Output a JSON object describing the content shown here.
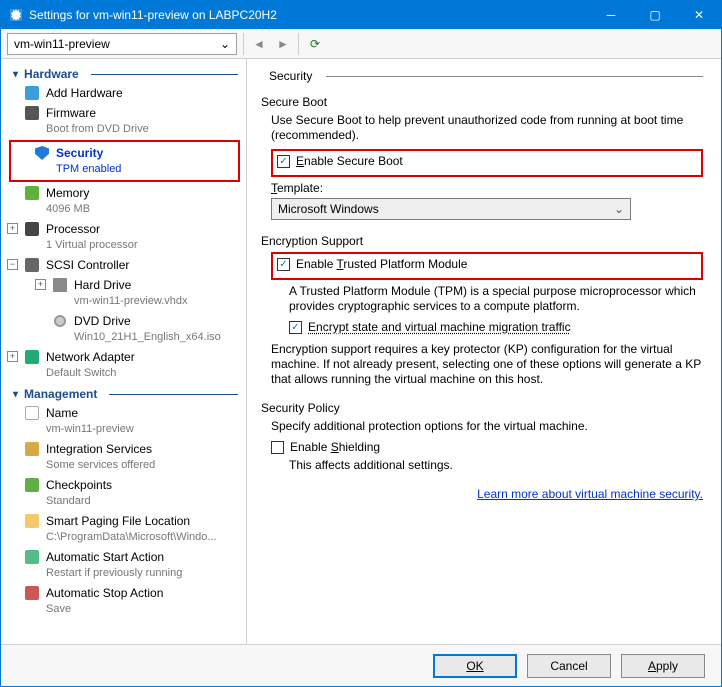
{
  "titlebar": {
    "text": "Settings for vm-win11-preview on LABPC20H2"
  },
  "toolbar": {
    "vm_name": "vm-win11-preview"
  },
  "sidebar": {
    "hardware_label": "Hardware",
    "management_label": "Management",
    "items": {
      "add_hardware": {
        "label": "Add Hardware"
      },
      "firmware": {
        "label": "Firmware",
        "sub": "Boot from DVD Drive"
      },
      "security": {
        "label": "Security",
        "sub": "TPM enabled"
      },
      "memory": {
        "label": "Memory",
        "sub": "4096 MB"
      },
      "processor": {
        "label": "Processor",
        "sub": "1 Virtual processor"
      },
      "scsi": {
        "label": "SCSI Controller"
      },
      "hard_drive": {
        "label": "Hard Drive",
        "sub": "vm-win11-preview.vhdx"
      },
      "dvd_drive": {
        "label": "DVD Drive",
        "sub": "Win10_21H1_English_x64.iso"
      },
      "network": {
        "label": "Network Adapter",
        "sub": "Default Switch"
      },
      "name": {
        "label": "Name",
        "sub": "vm-win11-preview"
      },
      "integration": {
        "label": "Integration Services",
        "sub": "Some services offered"
      },
      "checkpoints": {
        "label": "Checkpoints",
        "sub": "Standard"
      },
      "paging": {
        "label": "Smart Paging File Location",
        "sub": "C:\\ProgramData\\Microsoft\\Windo..."
      },
      "autostart": {
        "label": "Automatic Start Action",
        "sub": "Restart if previously running"
      },
      "autostop": {
        "label": "Automatic Stop Action",
        "sub": "Save"
      }
    }
  },
  "pane": {
    "title": "Security",
    "secure_boot": {
      "heading": "Secure Boot",
      "desc": "Use Secure Boot to help prevent unauthorized code from running at boot time (recommended).",
      "checkbox": "Enable Secure Boot",
      "template_label": "Template:",
      "template_value": "Microsoft Windows"
    },
    "encryption": {
      "heading": "Encryption Support",
      "tpm_checkbox": "Enable Trusted Platform Module",
      "tpm_desc": "A Trusted Platform Module (TPM) is a special purpose microprocessor which provides cryptographic services to a compute platform.",
      "migrate_checkbox": "Encrypt state and virtual machine migration traffic",
      "kp_desc": "Encryption support requires a key protector (KP) configuration for the virtual machine. If not already present, selecting one of these options will generate a KP that allows running the virtual machine on this host."
    },
    "policy": {
      "heading": "Security Policy",
      "desc": "Specify additional protection options for the virtual machine.",
      "shield_checkbox": "Enable Shielding",
      "shield_desc": "This affects additional settings."
    },
    "learn_more": "Learn more about virtual machine security."
  },
  "footer": {
    "ok": "OK",
    "cancel": "Cancel",
    "apply": "Apply"
  }
}
